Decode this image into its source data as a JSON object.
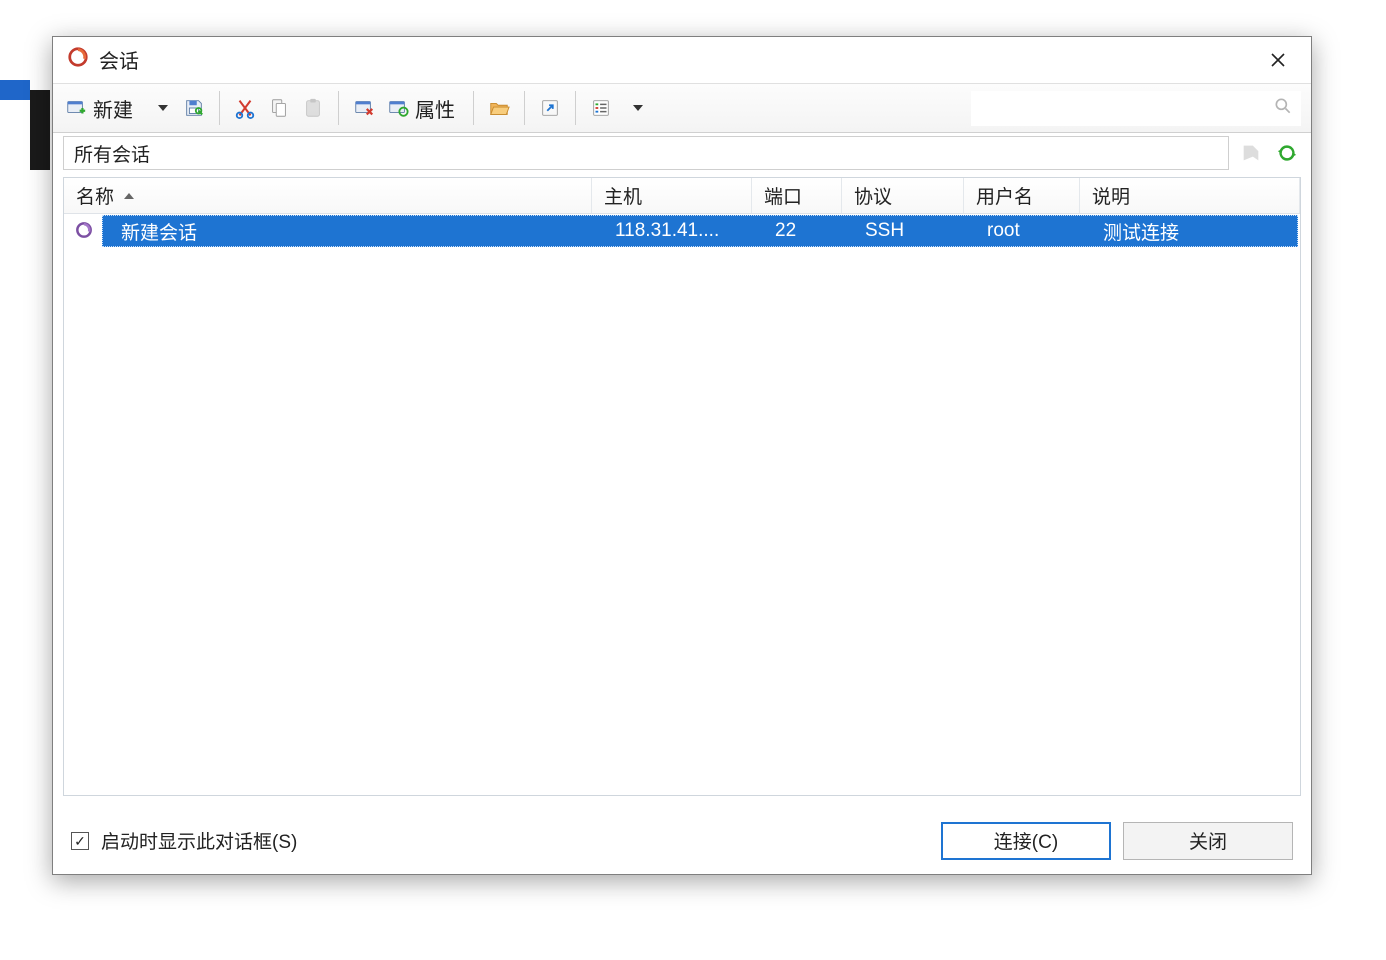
{
  "window": {
    "title": "会话"
  },
  "toolbar": {
    "new_label": "新建",
    "properties_label": "属性"
  },
  "location": {
    "path": "所有会话"
  },
  "table": {
    "headers": {
      "name": "名称",
      "host": "主机",
      "port": "端口",
      "protocol": "协议",
      "username": "用户名",
      "description": "说明"
    },
    "rows": [
      {
        "name": "新建会话",
        "host": "118.31.41....",
        "port": "22",
        "protocol": "SSH",
        "username": "root",
        "description": "测试连接",
        "selected": true
      }
    ]
  },
  "footer": {
    "show_on_start_label": "启动时显示此对话框(S)",
    "show_on_start_checked": true,
    "connect_label": "连接(C)",
    "close_label": "关闭"
  }
}
